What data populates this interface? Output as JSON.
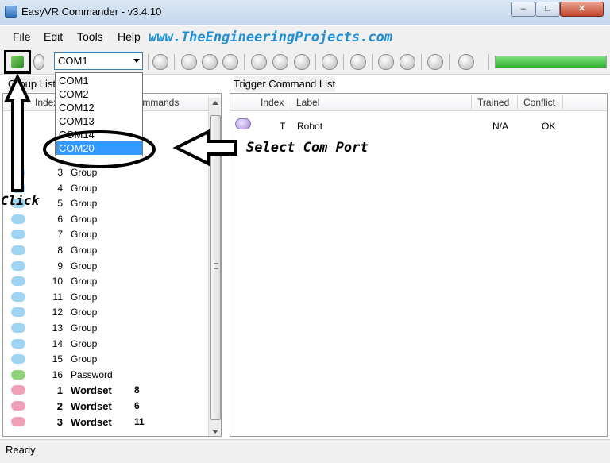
{
  "window": {
    "title": "EasyVR Commander - v3.4.10"
  },
  "menu": {
    "items": [
      "File",
      "Edit",
      "Tools",
      "Help"
    ]
  },
  "watermark": "www.TheEngineeringProjects.com",
  "toolbar": {
    "port_value": "COM1",
    "port_options": [
      "COM1",
      "COM2",
      "COM12",
      "COM13",
      "COM14",
      "COM20"
    ],
    "selected_option": "COM20",
    "progress_fraction": 1.0,
    "accent_color": "#2fb12f"
  },
  "group_list": {
    "title": "Group List",
    "columns": [
      "Index",
      "Commands"
    ],
    "rows": [
      {
        "index": "3",
        "label": "Group",
        "count": "",
        "color": "#9fd4f2"
      },
      {
        "index": "4",
        "label": "Group",
        "count": "",
        "color": "#9fd4f2"
      },
      {
        "index": "5",
        "label": "Group",
        "count": "",
        "color": "#9fd4f2"
      },
      {
        "index": "6",
        "label": "Group",
        "count": "",
        "color": "#9fd4f2"
      },
      {
        "index": "7",
        "label": "Group",
        "count": "",
        "color": "#9fd4f2"
      },
      {
        "index": "8",
        "label": "Group",
        "count": "",
        "color": "#9fd4f2"
      },
      {
        "index": "9",
        "label": "Group",
        "count": "",
        "color": "#9fd4f2"
      },
      {
        "index": "10",
        "label": "Group",
        "count": "",
        "color": "#9fd4f2"
      },
      {
        "index": "11",
        "label": "Group",
        "count": "",
        "color": "#9fd4f2"
      },
      {
        "index": "12",
        "label": "Group",
        "count": "",
        "color": "#9fd4f2"
      },
      {
        "index": "13",
        "label": "Group",
        "count": "",
        "color": "#9fd4f2"
      },
      {
        "index": "14",
        "label": "Group",
        "count": "",
        "color": "#9fd4f2"
      },
      {
        "index": "15",
        "label": "Group",
        "count": "",
        "color": "#9fd4f2"
      },
      {
        "index": "16",
        "label": "Password",
        "count": "",
        "color": "#8fd37a"
      },
      {
        "index": "1",
        "label": "Wordset",
        "count": "8",
        "color": "#f0a0b8"
      },
      {
        "index": "2",
        "label": "Wordset",
        "count": "6",
        "color": "#f0a0b8"
      },
      {
        "index": "3",
        "label": "Wordset",
        "count": "11",
        "color": "#f0a0b8"
      }
    ]
  },
  "trigger_list": {
    "title": "Trigger Command List",
    "columns": {
      "index": "Index",
      "label": "Label",
      "trained": "Trained",
      "conflict": "Conflict"
    },
    "rows": [
      {
        "index": "T",
        "label": "Robot",
        "trained": "N/A",
        "conflict": "OK"
      }
    ]
  },
  "annotations": {
    "click": "Click",
    "select": "Select Com Port",
    "color": "#000000"
  },
  "status": {
    "text": "Ready"
  }
}
